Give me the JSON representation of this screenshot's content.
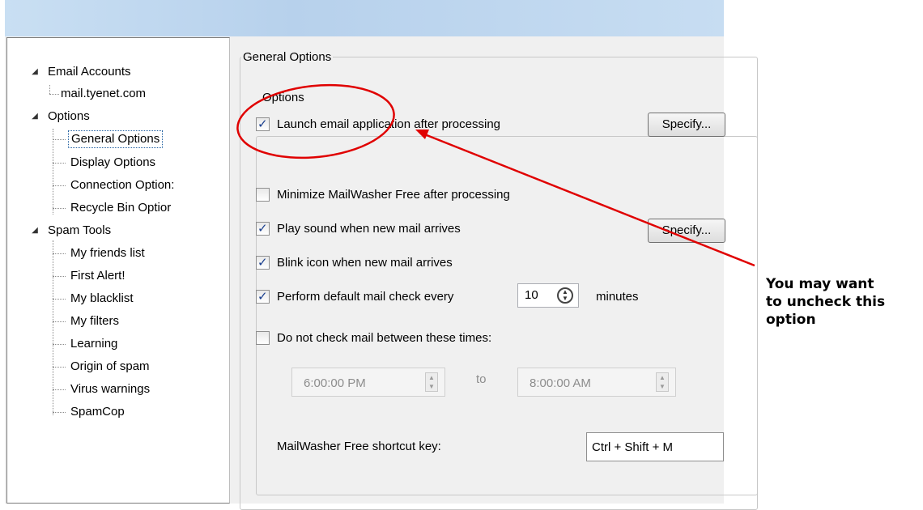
{
  "tree": {
    "email_accounts": "Email Accounts",
    "mail_account": "mail.tyenet.com",
    "options": "Options",
    "general_options": "General Options",
    "display_options": "Display Options",
    "connection_options": "Connection Option:",
    "recycle_bin_options": "Recycle Bin Optior",
    "spam_tools": "Spam Tools",
    "spam_items": [
      "My friends list",
      "First Alert!",
      "My blacklist",
      "My filters",
      "Learning",
      "Origin of spam",
      "Virus warnings",
      "SpamCop"
    ]
  },
  "general_options": {
    "group_title": "General Options",
    "options_group_title": "Options",
    "launch_email": {
      "label": "Launch email application after processing",
      "checked": true
    },
    "specify_button_1": "Specify...",
    "minimize": {
      "label": "Minimize MailWasher Free after processing",
      "checked": false
    },
    "play_sound": {
      "label": "Play sound when new mail arrives",
      "checked": true
    },
    "specify_button_2": "Specify...",
    "blink_icon": {
      "label": "Blink icon when new mail arrives",
      "checked": true
    },
    "default_check": {
      "label": "Perform default mail check every",
      "checked": true
    },
    "check_interval": "10",
    "minutes_label": "minutes",
    "do_not_check": {
      "label": "Do not check mail between these times:",
      "checked": false
    },
    "time_from": "6:00:00 PM",
    "to_label": "to",
    "time_to": "8:00:00 AM",
    "shortcut_label": "MailWasher Free shortcut key:",
    "shortcut_value": "Ctrl + Shift + M"
  },
  "annotation": {
    "text": "You may want\nto uncheck this\noption",
    "color": "#e00000"
  }
}
